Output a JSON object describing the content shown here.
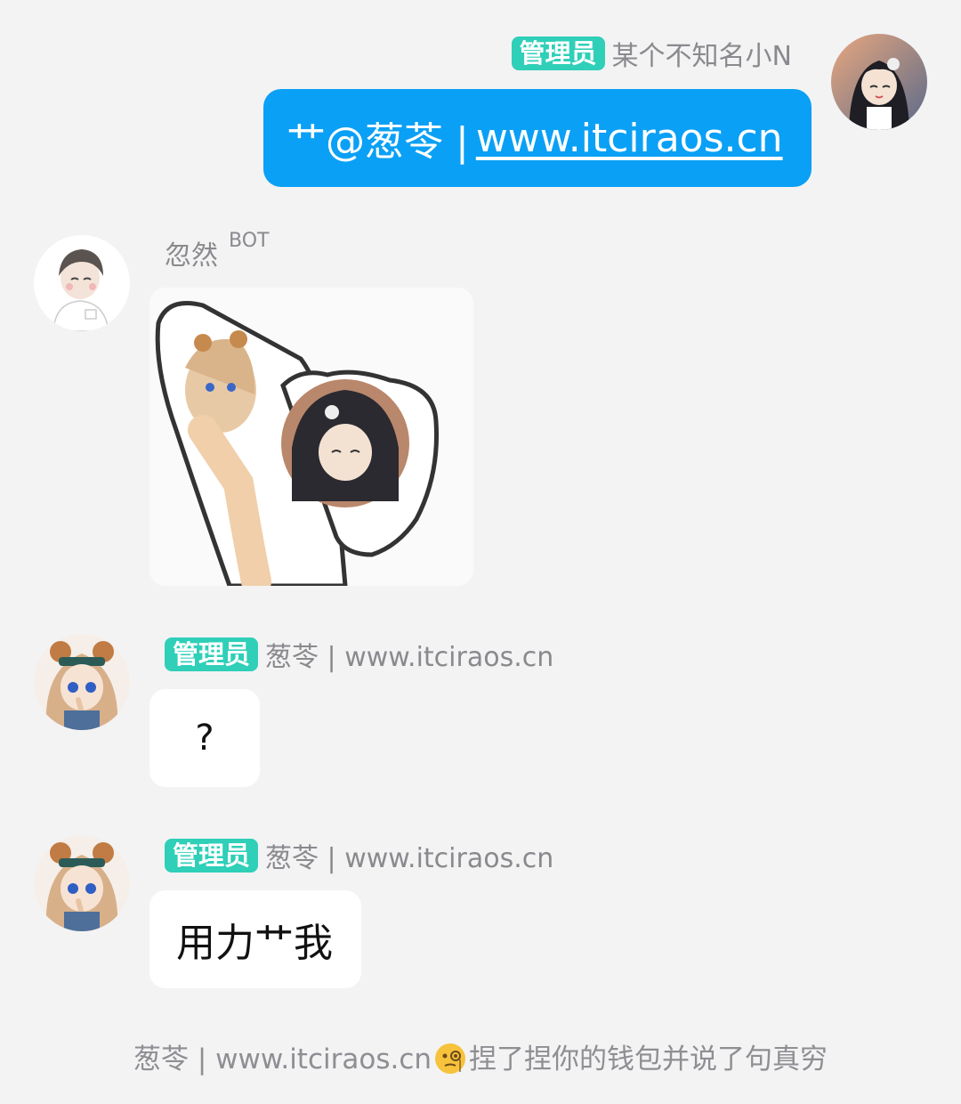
{
  "messages": {
    "outgoing": {
      "badge": "管理员",
      "sender": "某个不知名小N",
      "text_prefix": "艹@葱苓 | ",
      "text_link": "www.itciraos.cn"
    },
    "bot": {
      "sender": "忽然",
      "tag": "BOT"
    },
    "reply1": {
      "badge": "管理员",
      "sender": "葱苓 | www.itciraos.cn",
      "text": "?"
    },
    "reply2": {
      "badge": "管理员",
      "sender": "葱苓 | www.itciraos.cn",
      "text": "用力艹我"
    }
  },
  "system_notice": {
    "actor": "葱苓 | www.itciraos.cn",
    "action": "捏了捏你的钱包并说了句真穷",
    "emoji_icon": "face-with-monocle-emoji"
  },
  "colors": {
    "outgoing_bubble": "#0aa0f5",
    "admin_badge": "#2fcfb8",
    "background": "#f3f3f4"
  }
}
